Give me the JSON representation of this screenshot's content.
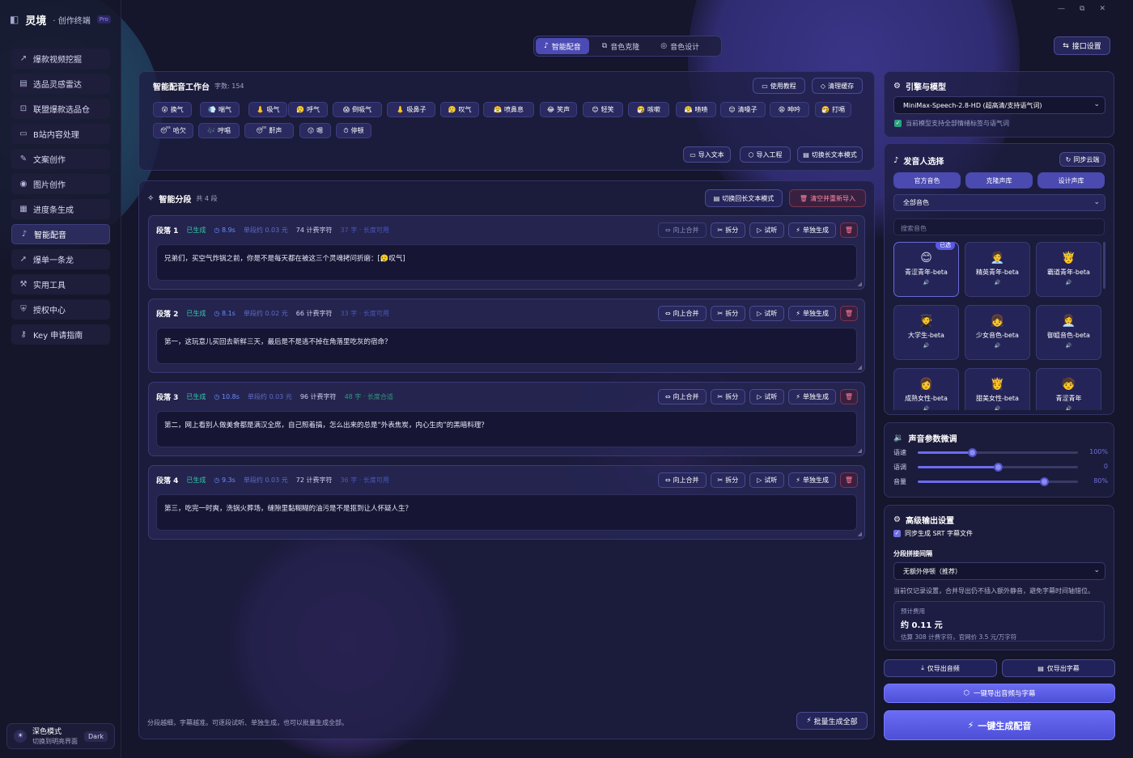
{
  "app": {
    "name": "灵境",
    "subtitle": "· 创作终端",
    "badge": "Pro"
  },
  "nav": [
    {
      "icon": "↗",
      "label": "爆款视频挖掘"
    },
    {
      "icon": "▤",
      "label": "选品灵感雷达"
    },
    {
      "icon": "⊡",
      "label": "联盟爆款选品仓"
    },
    {
      "icon": "▭",
      "label": "B站内容处理"
    },
    {
      "icon": "✎",
      "label": "文案创作"
    },
    {
      "icon": "◉",
      "label": "图片创作"
    },
    {
      "icon": "▦",
      "label": "进度条生成"
    },
    {
      "icon": "♪",
      "label": "智能配音"
    },
    {
      "icon": "➚",
      "label": "爆单一条龙"
    },
    {
      "icon": "⚒",
      "label": "实用工具"
    },
    {
      "icon": "⛨",
      "label": "授权中心"
    },
    {
      "icon": "⚷",
      "label": "Key 申请指南"
    }
  ],
  "theme": {
    "title": "深色模式",
    "sub": "切换到明亮界面",
    "badge": "Dark"
  },
  "window": {
    "minimize": "—",
    "maximize": "⧉",
    "close": "✕"
  },
  "tabs": [
    {
      "icon": "♪",
      "label": "智能配音"
    },
    {
      "icon": "⧉",
      "label": "音色克隆"
    },
    {
      "icon": "◎",
      "label": "音色设计"
    }
  ],
  "api_button": "接口设置",
  "workbench": {
    "title": "智能配音工作台",
    "char_count": "字数: 154",
    "tutorial": "使用教程",
    "clear_cache": "清理缓存",
    "chips": [
      {
        "e": "😮",
        "l": "换气"
      },
      {
        "e": "💨",
        "l": "喘气"
      },
      {
        "e": "👃",
        "l": "吸气"
      },
      {
        "e": "😮‍💨",
        "l": "呼气"
      },
      {
        "e": "😱",
        "l": "倒吸气"
      },
      {
        "e": "👃",
        "l": "吸鼻子"
      },
      {
        "e": "😮‍💨",
        "l": "叹气"
      },
      {
        "e": "😤",
        "l": "喷鼻息"
      },
      {
        "e": "😂",
        "l": "笑声"
      },
      {
        "e": "😊",
        "l": "轻笑"
      },
      {
        "e": "🤧",
        "l": "咳嗽"
      },
      {
        "e": "😤",
        "l": "啧啧"
      },
      {
        "e": "😌",
        "l": "清嗓子"
      },
      {
        "e": "😩",
        "l": "呻吟"
      },
      {
        "e": "🤧",
        "l": "打嗝"
      },
      {
        "e": "😴",
        "l": "哈欠"
      },
      {
        "e": "🎶",
        "l": "哼唱"
      },
      {
        "e": "😴",
        "l": "鼾声"
      },
      {
        "e": "😗",
        "l": "嗯"
      },
      {
        "e": "⏱",
        "l": "停顿"
      }
    ],
    "import_text": "导入文本",
    "import_project": "导入工程",
    "long_text_mode": "切换长文本模式"
  },
  "segments": {
    "title": "智能分段",
    "count": "共 4 段",
    "switch_back": "切换回长文本模式",
    "clear_reimport": "清空并重新导入",
    "merge": "向上合并",
    "split": "拆分",
    "listen": "试听",
    "generate": "单独生成",
    "items": [
      {
        "name": "段落 1",
        "status": "已生成",
        "dur": "8.9s",
        "cost": "单段约 0.03 元",
        "chars": "74 计费字符",
        "len": "37 字 · 长度可用",
        "text": "兄弟们，买空气炸锅之前，你是不是每天都在被这三个灵魂拷问折磨：[😮‍💨叹气]"
      },
      {
        "name": "段落 2",
        "status": "已生成",
        "dur": "8.1s",
        "cost": "单段约 0.02 元",
        "chars": "66 计费字符",
        "len": "33 字 · 长度可用",
        "text": "第一，这玩意儿买回去新鲜三天，最后是不是逃不掉在角落里吃灰的宿命？"
      },
      {
        "name": "段落 3",
        "status": "已生成",
        "dur": "10.8s",
        "cost": "单段约 0.03 元",
        "chars": "96 计费字符",
        "len": "48 字 · 长度合适",
        "text": "第二，网上看别人做美食都是满汉全席，自己照着搞，怎么出来的总是“外表焦炭，内心生肉”的黑暗料理？"
      },
      {
        "name": "段落 4",
        "status": "已生成",
        "dur": "9.3s",
        "cost": "单段约 0.03 元",
        "chars": "72 计费字符",
        "len": "36 字 · 长度可用",
        "text": "第三，吃完一时爽，洗锅火葬场，缝隙里黏糊糊的油污是不是抠到让人怀疑人生？"
      }
    ],
    "footer_note": "分段越细，字幕越准。可逐段试听、单独生成，也可以批量生成全部。",
    "batch": "批量生成全部"
  },
  "engine": {
    "title": "引擎与模型",
    "model": "MiniMax-Speech-2.8-HD (超高清/支持语气词)",
    "note": "当前模型支持全部情绪标签与语气词"
  },
  "speaker": {
    "title": "发音人选择",
    "sync": "同步云端",
    "tabs": [
      "官方音色",
      "克隆声库",
      "设计声库"
    ],
    "filter": "全部音色",
    "search_placeholder": "搜索音色",
    "selected_badge": "已选",
    "play": "🔊",
    "voices": [
      {
        "e": "😊",
        "n": "青涩青年-beta"
      },
      {
        "e": "🧑‍💼",
        "n": "精英青年-beta"
      },
      {
        "e": "🤴",
        "n": "霸道青年-beta"
      },
      {
        "e": "🧑‍🎓",
        "n": "大学生-beta"
      },
      {
        "e": "👧",
        "n": "少女音色-beta"
      },
      {
        "e": "👩‍💼",
        "n": "御姐音色-beta"
      },
      {
        "e": "👩",
        "n": "成熟女性-beta"
      },
      {
        "e": "👸",
        "n": "甜美女性-beta"
      },
      {
        "e": "🧒",
        "n": "青涩青年"
      }
    ]
  },
  "params": {
    "title": "声音参数微调",
    "items": [
      {
        "label": "语速",
        "value": "100%",
        "level": 0.34
      },
      {
        "label": "语调",
        "value": "0",
        "level": 0.5
      },
      {
        "label": "音量",
        "value": "80%",
        "level": 0.79
      }
    ]
  },
  "advanced": {
    "title": "高级输出设置",
    "srt": "同步生成 SRT 字幕文件",
    "gap_label": "分段拼接间隔",
    "gap_value": "无额外停顿（推荐）",
    "tip": "当前仅记录设置，合并导出仍不插入额外静音，避免字幕时间轴错位。",
    "cost_label": "预计费用",
    "cost_value": "约 0.11 元",
    "cost_detail": "估算 308 计费字符，官网价 3.5 元/万字符"
  },
  "actions": {
    "export_audio": "仅导出音频",
    "export_subs": "仅导出字幕",
    "export_all": "一键导出音频与字幕",
    "generate": "一键生成配音"
  },
  "colors": {
    "accent": "#4b4bb3",
    "success": "#34c7a8",
    "danger": "#ff8aa6",
    "background": "#15152b"
  }
}
